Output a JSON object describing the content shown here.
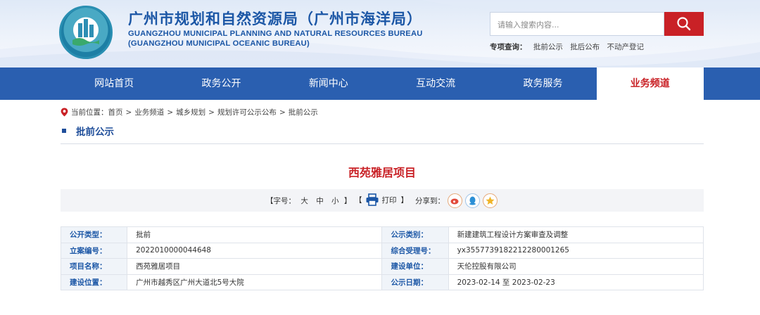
{
  "header": {
    "title": "广州市规划和自然资源局（广州市海洋局）",
    "title_en_1": "GUANGZHOU MUNICIPAL PLANNING AND NATURAL RESOURCES BUREAU",
    "title_en_2": "(GUANGZHOU MUNICIPAL OCEANIC BUREAU)",
    "search_placeholder": "请输入搜索内容...",
    "topics_label": "专项查询：",
    "topics": [
      "批前公示",
      "批后公布",
      "不动产登记"
    ]
  },
  "nav": {
    "items": [
      "网站首页",
      "政务公开",
      "新闻中心",
      "互动交流",
      "政务服务",
      "业务频道"
    ],
    "active_index": 5
  },
  "breadcrumb": {
    "label": "当前位置：",
    "items": [
      "首页",
      "业务频道",
      "城乡规划",
      "规划许可公示公布",
      "批前公示"
    ]
  },
  "section": {
    "title": "批前公示"
  },
  "article": {
    "title": "西苑雅居项目",
    "font_label_open": "【字号：",
    "font_sizes": [
      "大",
      "中",
      "小"
    ],
    "font_label_close": "】",
    "print_open": "【",
    "print_label": "打印",
    "print_close": "】",
    "share_label": "分享到："
  },
  "info_table": {
    "rows": [
      {
        "k1": "公开类型：",
        "v1": "批前",
        "k2": "公示类别：",
        "v2": "新建建筑工程设计方案审查及调整"
      },
      {
        "k1": "立案编号：",
        "v1": "2022010000044648",
        "k2": "综合受理号：",
        "v2": "yx3557739182212280001265"
      },
      {
        "k1": "项目名称：",
        "v1": "西苑雅居项目",
        "k2": "建设单位：",
        "v2": "天伦控股有限公司"
      },
      {
        "k1": "建设位置：",
        "v1": "广州市越秀区广州大道北5号大院",
        "k2": "公示日期：",
        "v2": "2023-02-14 至 2023-02-23"
      }
    ]
  },
  "colors": {
    "brand_blue": "#2a5fb0",
    "accent_red": "#c92126",
    "title_blue": "#1c57a6"
  },
  "icons": [
    "logo-emblem",
    "search-icon",
    "location-pin-icon",
    "print-icon",
    "weibo-icon",
    "qq-icon",
    "qzone-icon"
  ]
}
